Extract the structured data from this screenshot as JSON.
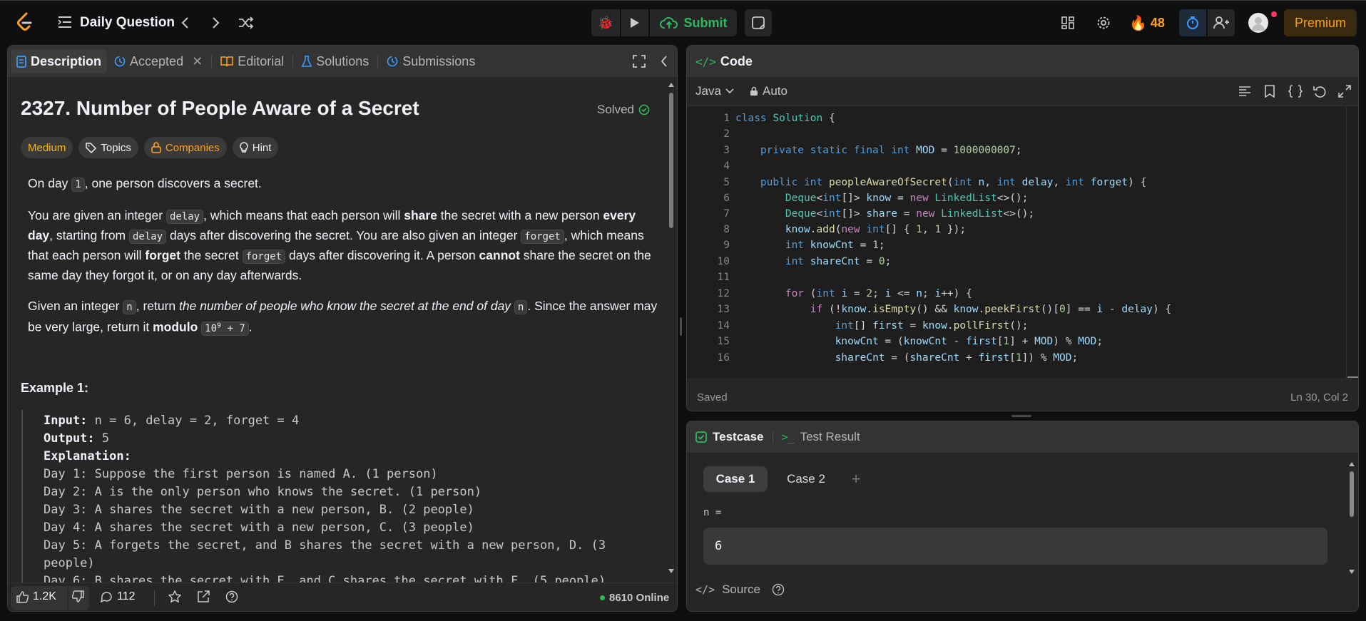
{
  "topbar": {
    "title": "Daily Question",
    "submit": "Submit",
    "streak": "48",
    "premium": "Premium"
  },
  "left": {
    "tabs": {
      "description": "Description",
      "accepted": "Accepted",
      "editorial": "Editorial",
      "solutions": "Solutions",
      "submissions": "Submissions"
    },
    "problem": {
      "title": "2327. Number of People Aware of a Secret",
      "status": "Solved",
      "difficulty": "Medium",
      "topics": "Topics",
      "companies": "Companies",
      "hint": "Hint"
    },
    "p1": {
      "a": "On day ",
      "c1": "1",
      "b": ", one person discovers a secret."
    },
    "p2": {
      "a": "You are given an integer ",
      "c1": "delay",
      "b": ", which means that each person will ",
      "s1": "share",
      "c": " the secret with a new person ",
      "s2": "every day",
      "d": ", starting from ",
      "c2": "delay",
      "e": " days after discovering the secret. You are also given an integer ",
      "c3": "forget",
      "f": ", which means that each person will ",
      "s3": "forget",
      "g": " the secret ",
      "c4": "forget",
      "h": " days after discovering it. A person ",
      "s4": "cannot",
      "i": " share the secret on the same day they forgot it, or on any day afterwards."
    },
    "p3": {
      "a": "Given an integer ",
      "c1": "n",
      "b": ", return ",
      "em": "the number of people who know the secret at the end of day ",
      "c2": "n",
      "c": ". Since the answer may be very large, return it ",
      "s1": "modulo",
      "c3a": "10",
      "c3sup": "9",
      "c3b": " + 7",
      "d": "."
    },
    "example_title": "Example 1:",
    "example": {
      "input_label": "Input:",
      "input": " n = 6, delay = 2, forget = 4",
      "output_label": "Output:",
      "output": " 5",
      "expl_label": "Explanation:",
      "lines": [
        "Day 1: Suppose the first person is named A. (1 person)",
        "Day 2: A is the only person who knows the secret. (1 person)",
        "Day 3: A shares the secret with a new person, B. (2 people)",
        "Day 4: A shares the secret with a new person, C. (3 people)",
        "Day 5: A forgets the secret, and B shares the secret with a new person, D. (3",
        "people)",
        "Day 6: B shares the secret with E, and C shares the secret with F. (5 people)"
      ]
    },
    "footer": {
      "likes": "1.2K",
      "comments": "112",
      "online": "8610 Online"
    }
  },
  "code": {
    "header": "Code",
    "language": "Java",
    "mode": "Auto",
    "saved": "Saved",
    "cursor": "Ln 30, Col 2",
    "line_numbers": [
      "1",
      "2",
      "3",
      "4",
      "5",
      "6",
      "7",
      "8",
      "9",
      "10",
      "11",
      "12",
      "13",
      "14",
      "15",
      "16"
    ]
  },
  "testcase": {
    "tab": "Testcase",
    "result_tab": "Test Result",
    "case1": "Case 1",
    "case2": "Case 2",
    "add": "+",
    "var_label": "n =",
    "value": "6",
    "source": "Source"
  },
  "colors": {
    "accent_green": "#2cbb5d",
    "medium": "#ffb800",
    "premium_bg": "#3a2a0f",
    "premium_text": "#ffa116",
    "streak": "#ffa116"
  }
}
